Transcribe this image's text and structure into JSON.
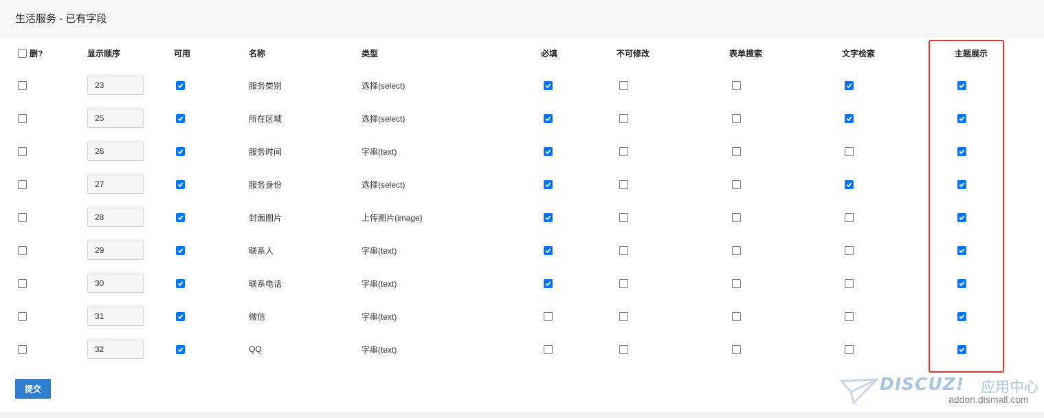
{
  "panel": {
    "title": "生活服务 - 已有字段"
  },
  "headers": {
    "delete": "删?",
    "order": "显示顺序",
    "available": "可用",
    "name": "名称",
    "type": "类型",
    "required": "必填",
    "unchangeable": "不可修改",
    "form_search": "表单搜索",
    "text_search": "文字检索",
    "theme_display": "主题展示"
  },
  "fields": [
    {
      "order": "23",
      "name": "服务类别",
      "type": "选择(select)",
      "delete": false,
      "available": true,
      "required": true,
      "unchangeable": false,
      "form_search": false,
      "text_search": true,
      "theme_display": true
    },
    {
      "order": "25",
      "name": "所在区域",
      "type": "选择(select)",
      "delete": false,
      "available": true,
      "required": true,
      "unchangeable": false,
      "form_search": false,
      "text_search": true,
      "theme_display": true
    },
    {
      "order": "26",
      "name": "服务时间",
      "type": "字串(text)",
      "delete": false,
      "available": true,
      "required": true,
      "unchangeable": false,
      "form_search": false,
      "text_search": false,
      "theme_display": true
    },
    {
      "order": "27",
      "name": "服务身份",
      "type": "选择(select)",
      "delete": false,
      "available": true,
      "required": true,
      "unchangeable": false,
      "form_search": false,
      "text_search": true,
      "theme_display": true
    },
    {
      "order": "28",
      "name": "封面图片",
      "type": "上传图片(image)",
      "delete": false,
      "available": true,
      "required": true,
      "unchangeable": false,
      "form_search": false,
      "text_search": false,
      "theme_display": true
    },
    {
      "order": "29",
      "name": "联系人",
      "type": "字串(text)",
      "delete": false,
      "available": true,
      "required": true,
      "unchangeable": false,
      "form_search": false,
      "text_search": false,
      "theme_display": true
    },
    {
      "order": "30",
      "name": "联系电话",
      "type": "字串(text)",
      "delete": false,
      "available": true,
      "required": true,
      "unchangeable": false,
      "form_search": false,
      "text_search": false,
      "theme_display": true
    },
    {
      "order": "31",
      "name": "微信",
      "type": "字串(text)",
      "delete": false,
      "available": true,
      "required": false,
      "unchangeable": false,
      "form_search": false,
      "text_search": false,
      "theme_display": true
    },
    {
      "order": "32",
      "name": "QQ",
      "type": "字串(text)",
      "delete": false,
      "available": true,
      "required": false,
      "unchangeable": false,
      "form_search": false,
      "text_search": false,
      "theme_display": true
    }
  ],
  "submit_label": "提交",
  "watermark": {
    "logo": "DISCUZ!",
    "suffix": "应用中心",
    "url": "addon.dismall.com"
  },
  "colors": {
    "accent": "#0075ff",
    "button": "#2f7fd1",
    "highlight": "#e0372c"
  },
  "icons": {
    "checkbox_check": "check-icon",
    "watermark_plane": "paper-plane-icon"
  }
}
